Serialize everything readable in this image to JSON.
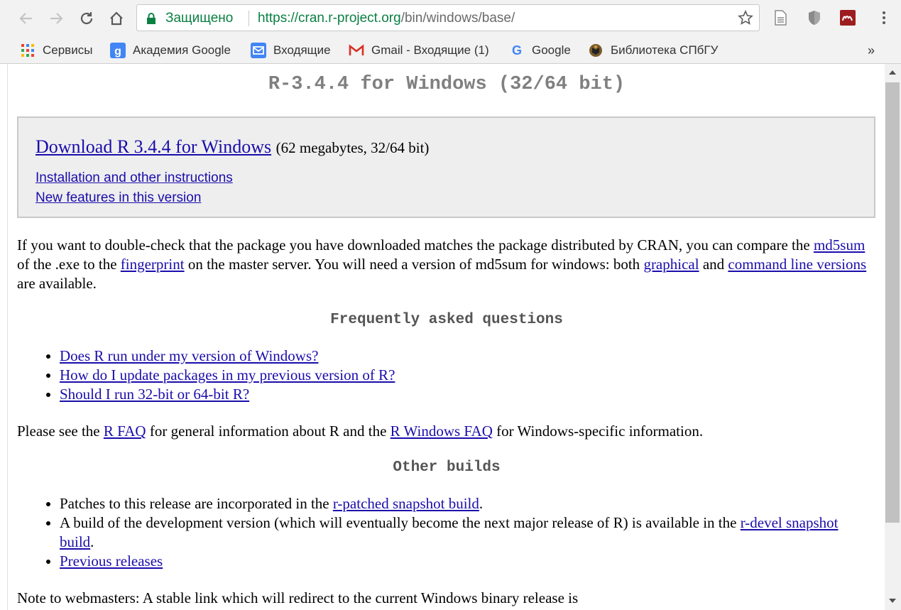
{
  "browser": {
    "secure_label": "Защищено",
    "url_host": "https://cran.r-project.org",
    "url_path": "/bin/windows/base/",
    "bookmarks": [
      {
        "label": "Сервисы",
        "icon": "apps-grid-icon"
      },
      {
        "label": "Академия Google",
        "icon": "scholar-icon"
      },
      {
        "label": "Входящие",
        "icon": "inbox-icon"
      },
      {
        "label": "Gmail - Входящие (1)",
        "icon": "gmail-icon"
      },
      {
        "label": "Google",
        "icon": "google-icon"
      },
      {
        "label": "Библиотека СПбГУ",
        "icon": "library-crest-icon"
      }
    ],
    "bookmarks_overflow": "»"
  },
  "page": {
    "title": "R-3.4.4 for Windows (32/64 bit)",
    "download": {
      "link_text": "Download R 3.4.4 for Windows",
      "meta": "(62 megabytes, 32/64 bit)",
      "install_link": "Installation and other instructions",
      "features_link": "New features in this version"
    },
    "check": {
      "t1": "If you want to double-check that the package you have downloaded matches the package distributed by CRAN, you can compare the ",
      "md5sum_link": "md5sum",
      "t2": " of the .exe to the ",
      "fingerprint_link": "fingerprint",
      "t3": " on the master server. You will need a version of md5sum for windows: both ",
      "graphical_link": "graphical",
      "t4": " and ",
      "cmdline_link": "command line versions",
      "t5": " are available."
    },
    "faq_heading": "Frequently asked questions",
    "faq_items": [
      "Does R run under my version of Windows?",
      "How do I update packages in my previous version of R?",
      "Should I run 32-bit or 64-bit R?"
    ],
    "rfaq": {
      "t1": "Please see the ",
      "rfaq_link": "R FAQ",
      "t2": " for general information about R and the ",
      "rwinfaq_link": "R Windows FAQ",
      "t3": " for Windows-specific information."
    },
    "builds_heading": "Other builds",
    "builds": {
      "b1_t1": "Patches to this release are incorporated in the ",
      "b1_link": "r-patched snapshot build",
      "b1_t2": ".",
      "b2_t1": "A build of the development version (which will eventually become the next major release of R) is available in the ",
      "b2_link": "r-devel snapshot build",
      "b2_t2": ".",
      "b3_link": "Previous releases"
    },
    "webmasters_note": "Note to webmasters: A stable link which will redirect to the current Windows binary release is"
  }
}
